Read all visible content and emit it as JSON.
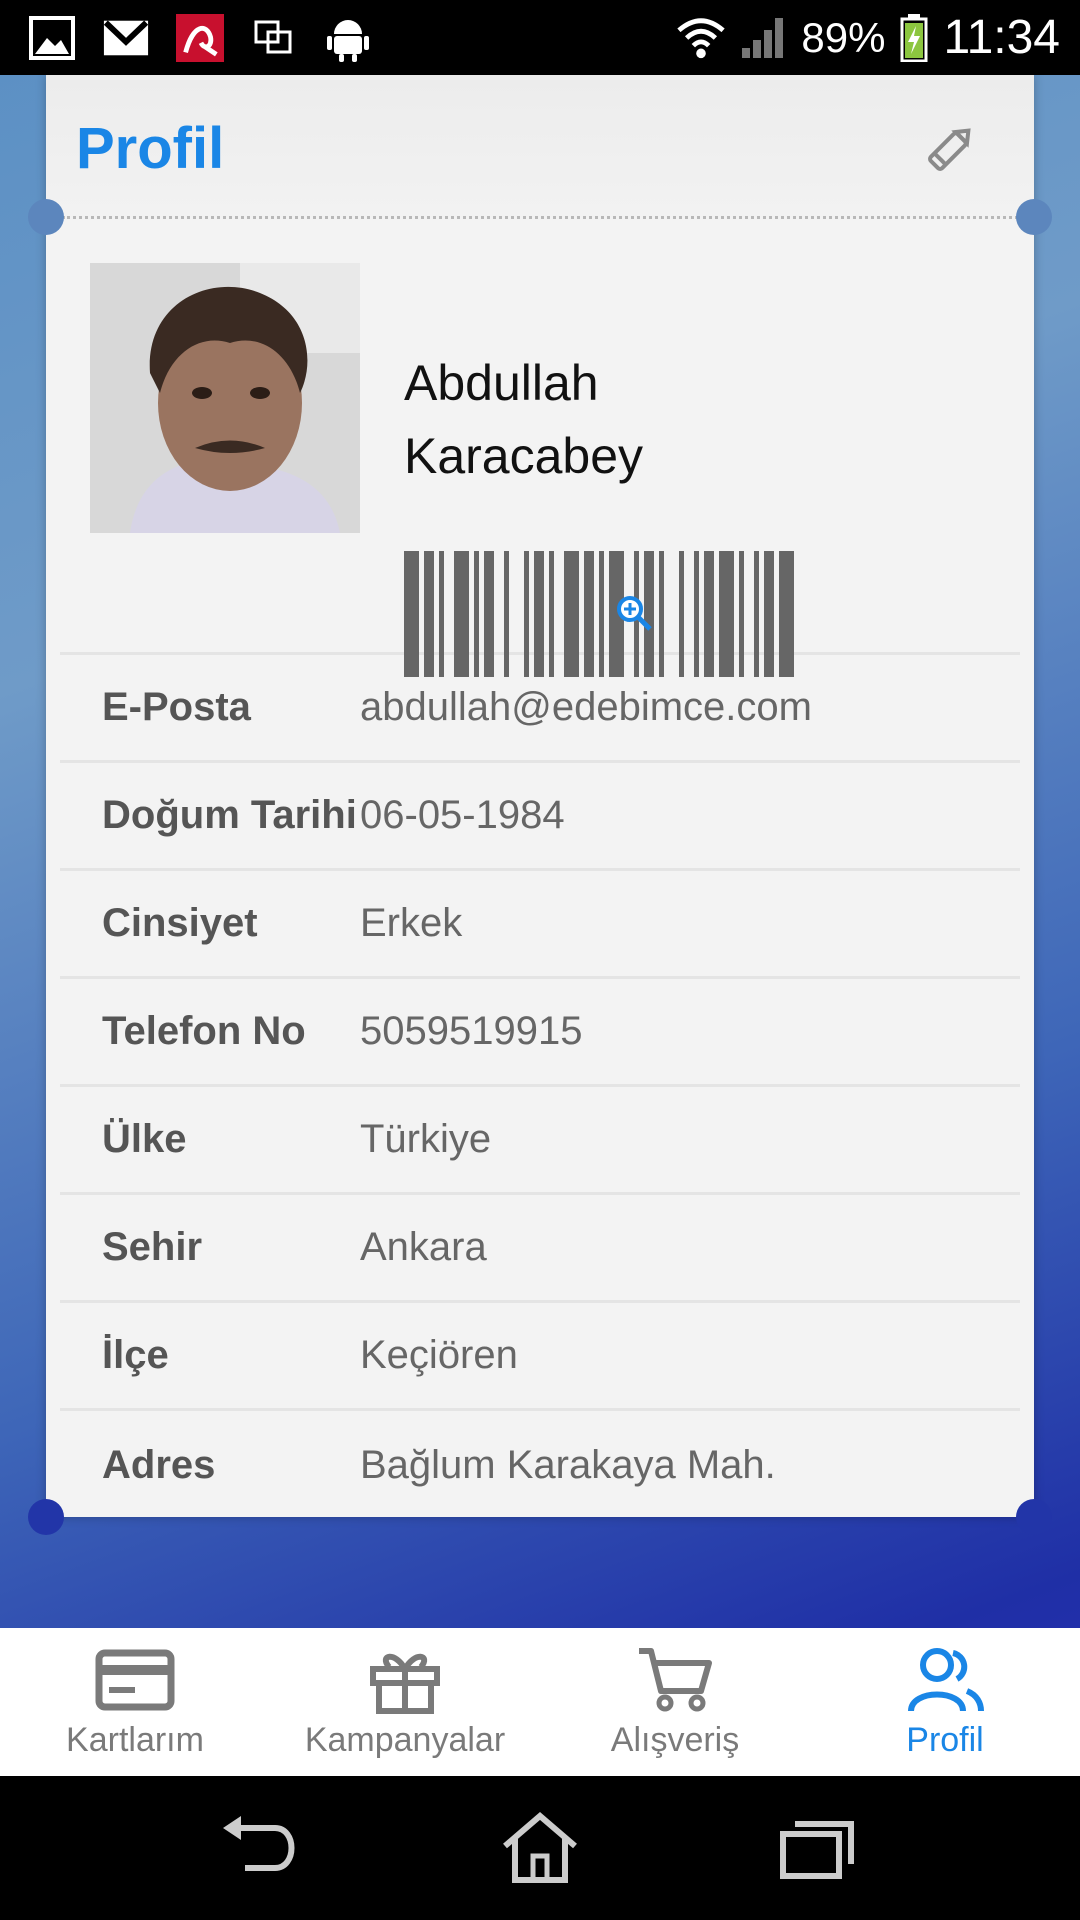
{
  "status_bar": {
    "battery_percent": "89%",
    "time": "11:34",
    "icons": [
      "gallery-icon",
      "gmail-icon",
      "avira-icon",
      "screen-mirror-icon",
      "android-icon",
      "wifi-icon",
      "signal-icon",
      "battery-charging-icon"
    ]
  },
  "header": {
    "title": "Profil",
    "edit_icon": "pencil-icon"
  },
  "profile": {
    "name": "Abdullah Karacabey",
    "avatar_icon": "user-photo",
    "barcode_icon": "barcode-icon",
    "zoom_icon": "zoom-in-icon"
  },
  "info_rows": [
    {
      "label": "E-Posta",
      "value": "abdullah@edebimce.com"
    },
    {
      "label": "Doğum Tarihi",
      "value": "06-05-1984"
    },
    {
      "label": "Cinsiyet",
      "value": "Erkek"
    },
    {
      "label": "Telefon No",
      "value": "5059519915"
    },
    {
      "label": "Ülke",
      "value": "Türkiye"
    },
    {
      "label": "Sehir",
      "value": "Ankara"
    },
    {
      "label": "İlçe",
      "value": "Keçiören"
    },
    {
      "label": "Adres",
      "value": "Bağlum Karakaya Mah."
    }
  ],
  "bottom_nav": [
    {
      "label": "Kartlarım",
      "icon": "card-icon",
      "active": false
    },
    {
      "label": "Kampanyalar",
      "icon": "gift-icon",
      "active": false
    },
    {
      "label": "Alışveriş",
      "icon": "cart-icon",
      "active": false
    },
    {
      "label": "Profil",
      "icon": "users-icon",
      "active": true
    }
  ],
  "colors": {
    "accent": "#1a86e6",
    "inactive": "#7a7a7a",
    "card_bg": "#f3f3f3"
  }
}
